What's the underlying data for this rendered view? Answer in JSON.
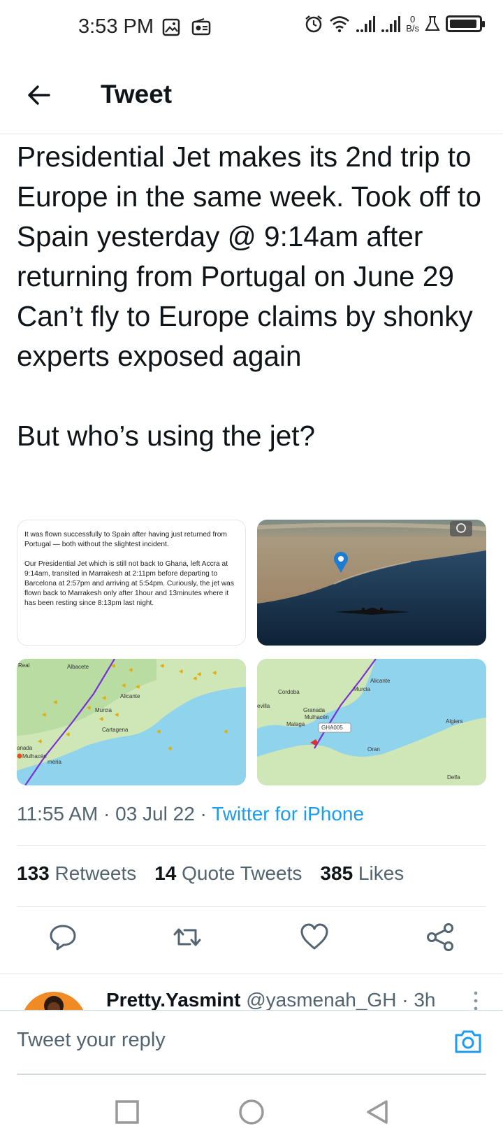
{
  "status_bar": {
    "time": "3:53 PM",
    "net_speed_value": "0",
    "net_speed_unit": "B/s",
    "icons": [
      "gallery-icon",
      "radio-icon",
      "alarm-icon",
      "wifi-icon",
      "signal-icon",
      "signal-icon",
      "lab-icon",
      "battery-icon"
    ]
  },
  "header": {
    "title": "Tweet"
  },
  "tweet": {
    "text": "Presidential Jet makes its 2nd trip to Europe in the same week. Took off to Spain yesterday @ 9:14am after returning from Portugal on June 29\nCan’t fly to Europe claims by shonky experts exposed again\n\nBut who’s using the jet?",
    "media": {
      "doc_text": "It was flown successfully to Spain after having just returned from Portugal — both without the slightest incident.\n\nOur Presidential Jet which is still not back to Ghana, left Accra at 9:14am, transited in Marrakesh at 2:11pm before departing to Barcelona at 2:57pm and arriving at 5:54pm. Curiously, the jet was flown back to Marrakesh only after 1hour and 13minutes where it has been resting since 8:13pm last night.",
      "map1_labels": [
        "Real",
        "Albacete",
        "Alicante",
        "Murcia",
        "Cartagena",
        "anada",
        "Mulhacén",
        "meria"
      ],
      "map2_labels": [
        "Alicante",
        "Cordoba",
        "Murcia",
        "evilla",
        "Granada",
        "Mulhacén",
        "Malaga",
        "GHA005",
        "Algiers",
        "Oran",
        "Delfa"
      ]
    },
    "time": "11:55 AM",
    "date": "03 Jul 22",
    "source": "Twitter for iPhone",
    "stats": {
      "retweets_count": "133",
      "retweets_label": "Retweets",
      "quotes_count": "14",
      "quotes_label": "Quote Tweets",
      "likes_count": "385",
      "likes_label": "Likes"
    }
  },
  "reply": {
    "name": "Pretty.Yasmint",
    "handle": "@yasmenah_GH",
    "age": "3h"
  },
  "reply_bar": {
    "placeholder": "Tweet your reply"
  },
  "colors": {
    "accent": "#1d9bf0",
    "text_primary": "#0f1419",
    "text_secondary": "#536471",
    "divider": "#e1e4e8"
  }
}
